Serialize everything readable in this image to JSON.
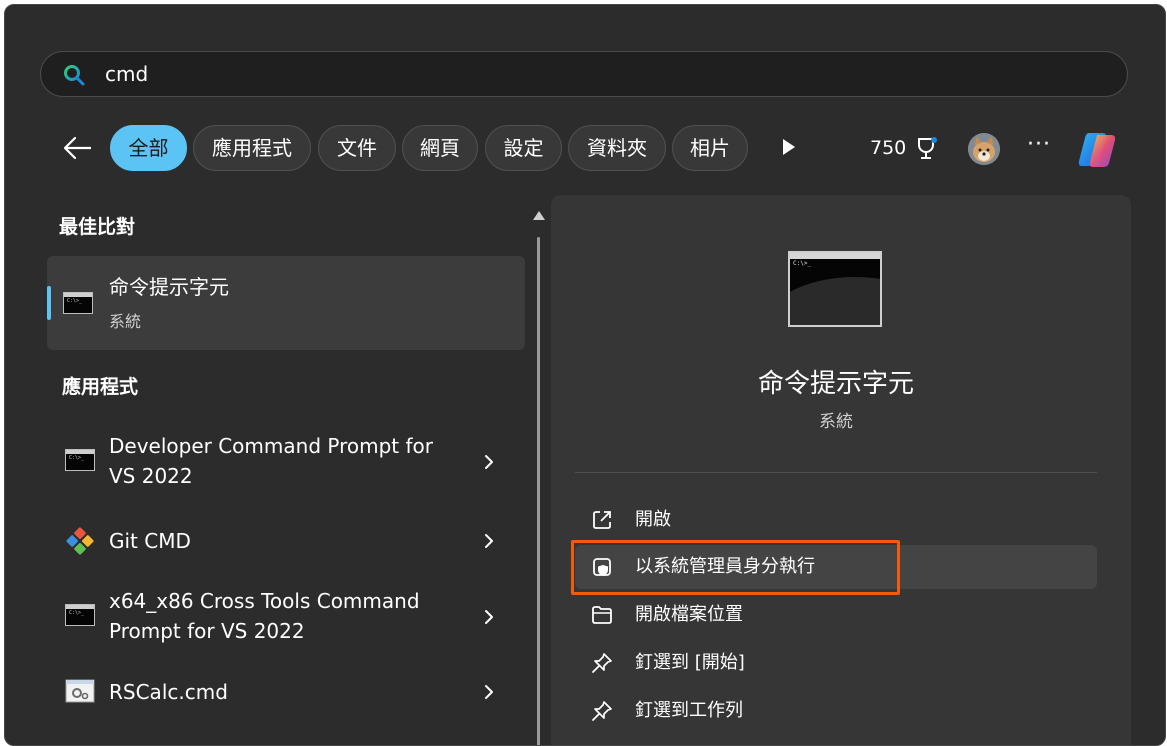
{
  "search": {
    "value": "cmd"
  },
  "tabs": [
    {
      "label": "全部",
      "active": true
    },
    {
      "label": "應用程式"
    },
    {
      "label": "文件"
    },
    {
      "label": "網頁"
    },
    {
      "label": "設定"
    },
    {
      "label": "資料夾"
    },
    {
      "label": "相片"
    }
  ],
  "toolbar": {
    "points": "750",
    "more_label": "···"
  },
  "best_match": {
    "header": "最佳比對",
    "title": "命令提示字元",
    "subtitle": "系統",
    "icon": "cmd-icon",
    "icon_text": "C:\\>_"
  },
  "apps": {
    "header": "應用程式",
    "items": [
      {
        "title": "Developer Command Prompt for VS 2022",
        "title_line1": "Developer Command Prompt for",
        "title_line2": "VS 2022",
        "icon": "cmd-icon",
        "icon_text": "C:\\>_"
      },
      {
        "title": "Git CMD",
        "icon": "git-icon"
      },
      {
        "title": "x64_x86 Cross Tools Command Prompt for VS 2022",
        "title_line1": "x64_x86 Cross Tools Command",
        "title_line2": "Prompt for VS 2022",
        "icon": "cmd-icon",
        "icon_text": "C:\\>_"
      },
      {
        "title": "RSCalc.cmd",
        "icon": "gear-file-icon"
      }
    ]
  },
  "detail": {
    "title": "命令提示字元",
    "subtitle": "系統",
    "icon_text": "C:\\>_",
    "actions": [
      {
        "label": "開啟",
        "icon": "open-external-icon"
      },
      {
        "label": "以系統管理員身分執行",
        "icon": "shield-icon"
      },
      {
        "label": "開啟檔案位置",
        "icon": "folder-icon"
      },
      {
        "label": "釘選到 [開始]",
        "icon": "pin-icon"
      },
      {
        "label": "釘選到工作列",
        "icon": "pin-icon"
      }
    ]
  },
  "colors": {
    "accent": "#5cc4f5",
    "highlight": "#f15a10",
    "window": "#2c2c2c",
    "panel": "#363636"
  }
}
